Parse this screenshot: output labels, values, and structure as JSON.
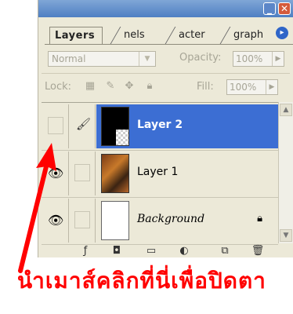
{
  "window": {
    "minimize_icon": "minimize-icon",
    "close_icon": "close-icon",
    "min_glyph": "_",
    "close_glyph": "✕"
  },
  "tabs": [
    {
      "label": "Layers",
      "active": true
    },
    {
      "label": "nels",
      "active": false
    },
    {
      "label": "acter",
      "active": false
    },
    {
      "label": "graph",
      "active": false
    }
  ],
  "tab_menu_glyph": "▸",
  "blend_mode": {
    "value": "Normal"
  },
  "opacity": {
    "label": "Opacity:",
    "value": "100%"
  },
  "lock": {
    "label": "Lock:"
  },
  "fill": {
    "label": "Fill:",
    "value": "100%"
  },
  "layers": [
    {
      "name": "Layer 2",
      "selected": true,
      "thumbnail": "mask",
      "visible": false
    },
    {
      "name": "Layer 1",
      "selected": false,
      "thumbnail": "poster",
      "visible": true
    },
    {
      "name": "Background",
      "selected": false,
      "thumbnail": "white",
      "visible": true,
      "locked": true
    }
  ],
  "colors": {
    "selection": "#3c6ed3",
    "annotation": "#ff0000",
    "panel_bg": "#ece9d8"
  },
  "annotation_text": "นำเมาส์คลิกที่นี่เพื่อปิดตา"
}
